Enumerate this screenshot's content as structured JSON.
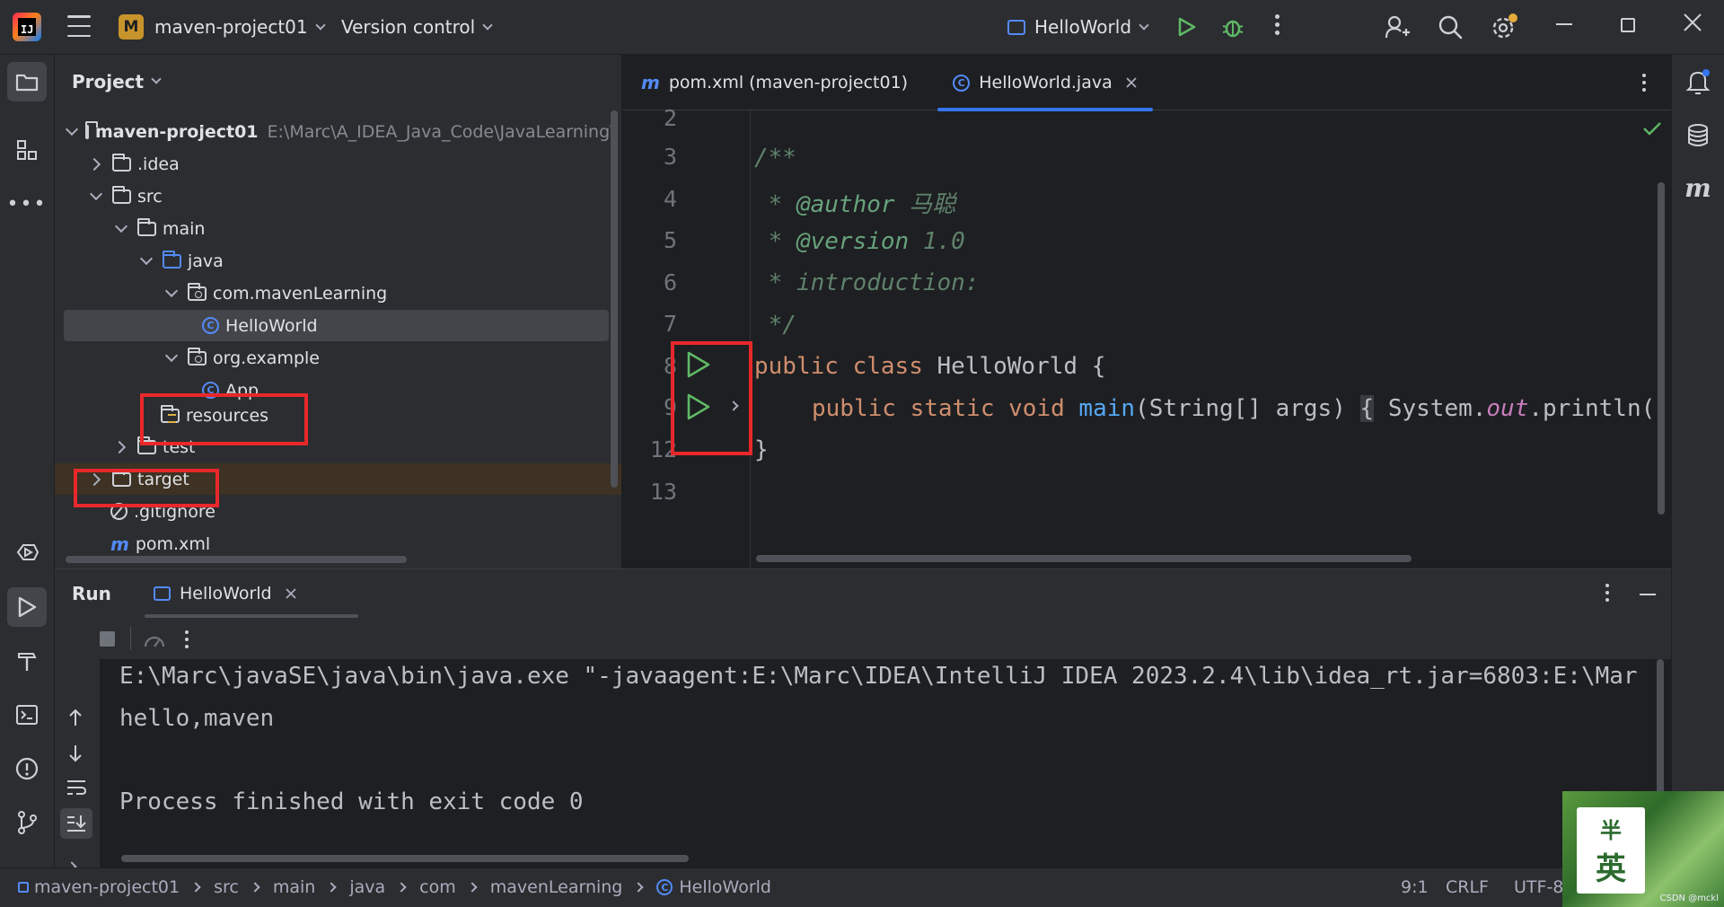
{
  "titlebar": {
    "project_badge": "M",
    "project_name": "maven-project01",
    "vcs_label": "Version control",
    "run_config": "HelloWorld"
  },
  "project_panel": {
    "title": "Project",
    "tree": [
      {
        "label": "maven-project01",
        "extra": "E:\\Marc\\A_IDEA_Java_Code\\JavaLearning\\"
      },
      {
        "label": ".idea"
      },
      {
        "label": "src"
      },
      {
        "label": "main"
      },
      {
        "label": "java"
      },
      {
        "label": "com.mavenLearning"
      },
      {
        "label": "HelloWorld"
      },
      {
        "label": "org.example"
      },
      {
        "label": "App"
      },
      {
        "label": "resources"
      },
      {
        "label": "test"
      },
      {
        "label": "target"
      },
      {
        "label": ".gitignore"
      },
      {
        "label": "pom.xml"
      }
    ]
  },
  "editor": {
    "tabs": [
      {
        "label": "pom.xml (maven-project01)"
      },
      {
        "label": "HelloWorld.java"
      }
    ],
    "line_numbers": [
      "2",
      "3",
      "4",
      "5",
      "6",
      "7",
      "8",
      "9",
      "12",
      "13"
    ],
    "code": {
      "l3": "/**",
      "l4_star": " * ",
      "l4_tag": "@author",
      "l4_val": " 马聪",
      "l5_star": " * ",
      "l5_tag": "@version",
      "l5_val": " 1.0",
      "l6": " * introduction:",
      "l7": " */",
      "l8_kw1": "public",
      "l8_kw2": "class",
      "l8_name": "HelloWorld {",
      "l9_kw": "public static void",
      "l9_fn": "main",
      "l9_args": "(String[] args)",
      "l9_brace": "{",
      "l9_sys": "System.",
      "l9_out": "out",
      "l9_rest": ".println(",
      "l12": "}"
    }
  },
  "run_panel": {
    "title": "Run",
    "tab_label": "HelloWorld",
    "console": [
      "E:\\Marc\\javaSE\\java\\bin\\java.exe \"-javaagent:E:\\Marc\\IDEA\\IntelliJ IDEA 2023.2.4\\lib\\idea_rt.jar=6803:E:\\Mar",
      "hello,maven",
      "",
      "Process finished with exit code 0"
    ]
  },
  "statusbar": {
    "breadcrumbs": [
      "maven-project01",
      "src",
      "main",
      "java",
      "com",
      "mavenLearning",
      "HelloWorld"
    ],
    "position": "9:1",
    "line_sep": "CRLF",
    "encoding": "UTF-8"
  },
  "watermark": {
    "char1": "半",
    "char2": "英",
    "csdn": "CSDN @mckl"
  },
  "colors": {
    "accent": "#3574f0",
    "run_green": "#5fb865",
    "highlight_red": "#e8282b"
  }
}
